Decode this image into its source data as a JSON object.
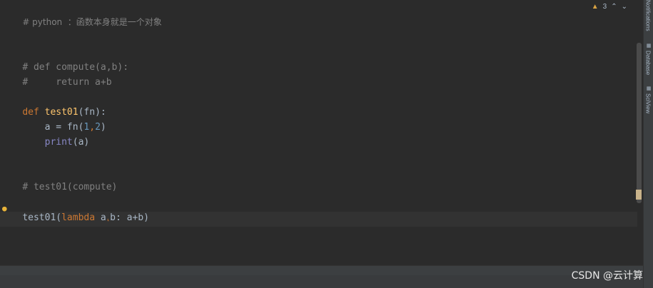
{
  "editor": {
    "lines": {
      "l1": "# python  ：函数本身就是一个对象",
      "l2_a": "# def compute(a,b):",
      "l3_a": "#     return a+b",
      "l4_kw": "def",
      "l4_fn": "test01",
      "l4_rest": "(fn):",
      "l5_a": "    a = fn(",
      "l5_n1": "1",
      "l5_c": ",",
      "l5_n2": "2",
      "l5_e": ")",
      "l6_sp": "    ",
      "l6_bi": "print",
      "l6_rest": "(a)",
      "l7": "# test01(compute)",
      "l8_a": "test01(",
      "l8_kw": "lambda",
      "l8_b": " a",
      "l8_hint": "⸤",
      "l8_c": "b: a+b)"
    }
  },
  "inspections": {
    "warning_count": "3"
  },
  "right_toolbar": {
    "notifications": "Notifications",
    "database": "Database",
    "sciview": "SciView"
  },
  "watermark": {
    "text": "CSDN @云计算"
  }
}
